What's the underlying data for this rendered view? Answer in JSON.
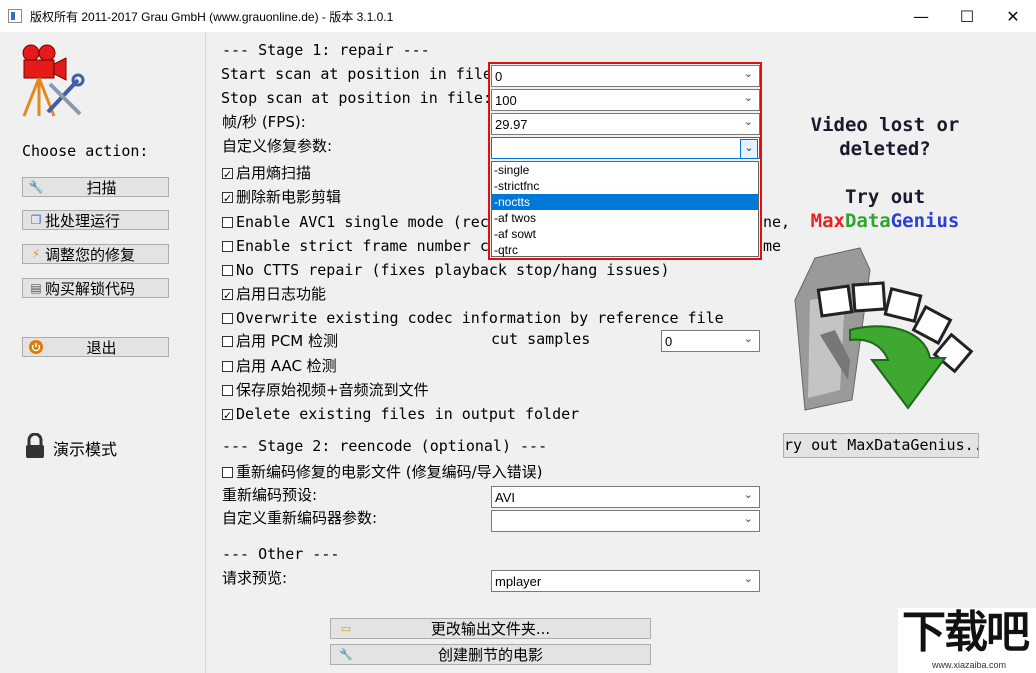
{
  "window": {
    "title": "版权所有 2011-2017 Grau GmbH (www.grauonline.de) - 版本 3.1.0.1",
    "minimize": "—",
    "maximize": "☐",
    "close": "✕"
  },
  "sidebar": {
    "choose_action": "Choose action:",
    "buttons": [
      {
        "label": "扫描",
        "icon": "wrench-icon"
      },
      {
        "label": "批处理运行",
        "icon": "batch-icon"
      },
      {
        "label": "调整您的修复",
        "icon": "lightning-icon"
      },
      {
        "label": "购买解锁代码",
        "icon": "shop-icon"
      },
      {
        "label": "退出",
        "icon": "power-icon"
      }
    ],
    "demo_mode": "演示模式"
  },
  "stage1": {
    "heading": "--- Stage 1: repair ---",
    "start_scan_label": "Start scan at position in file:",
    "start_scan_value": "0",
    "stop_scan_label": "Stop scan at position in file:",
    "stop_scan_value": "100",
    "fps_label": "帧/秒 (FPS):",
    "fps_value": "29.97",
    "custom_params_label": "自定义修复参数:",
    "custom_params_value": "",
    "dropdown_options": [
      "-single",
      "-strictfnc",
      "-noctts",
      "-af twos",
      "-af sowt",
      "-qtrc"
    ],
    "dropdown_selected": "-noctts",
    "options": [
      {
        "label": "启用熵扫描",
        "checked": true
      },
      {
        "label": "删除新电影剪辑",
        "checked": true
      },
      {
        "label": "Enable AVC1 single mode (rec",
        "checked": false,
        "tail": "ne,"
      },
      {
        "label": "Enable strict frame number c",
        "checked": false,
        "tail": "me"
      },
      {
        "label": "No CTTS repair (fixes playback stop/hang issues)",
        "checked": false
      },
      {
        "label": "启用日志功能",
        "checked": true
      },
      {
        "label": "Overwrite existing codec information by reference file",
        "checked": false
      },
      {
        "label": "启用 PCM 检测",
        "checked": false
      },
      {
        "label": "启用 AAC 检测",
        "checked": false
      },
      {
        "label": "保存原始视频+音频流到文件",
        "checked": false
      },
      {
        "label": "Delete existing files in output folder",
        "checked": true
      }
    ],
    "cut_samples_label": "cut samples",
    "cut_samples_value": "0"
  },
  "stage2": {
    "heading": "--- Stage 2: reencode (optional) ---",
    "reencode_label": "重新编码修复的电影文件 (修复编码/导入错误)",
    "reencode_checked": false,
    "preset_label": "重新编码预设:",
    "preset_value": "AVI",
    "custom_reencoder_label": "自定义重新编码器参数:",
    "custom_reencoder_value": ""
  },
  "other": {
    "heading": "--- Other ---",
    "preview_label": "请求预览:",
    "preview_value": "mplayer"
  },
  "bottom_buttons": {
    "change_output": "更改输出文件夹...",
    "create_cut": "创建删节的电影"
  },
  "ad": {
    "line1": "Video lost or",
    "line2": "deleted?",
    "try_out": "Try out",
    "brand_part1": "Max",
    "brand_part2": "Data",
    "brand_part3": "Genius",
    "button": "ry out MaxDataGenius.."
  },
  "watermark": {
    "main": "下载吧",
    "url": "www.xiazaiba.com"
  },
  "colors": {
    "highlight_border": "#e01010",
    "selection": "#0078d7",
    "brand_red": "#e8231f",
    "brand_green": "#2fa52f",
    "brand_blue": "#2a3fd6"
  }
}
